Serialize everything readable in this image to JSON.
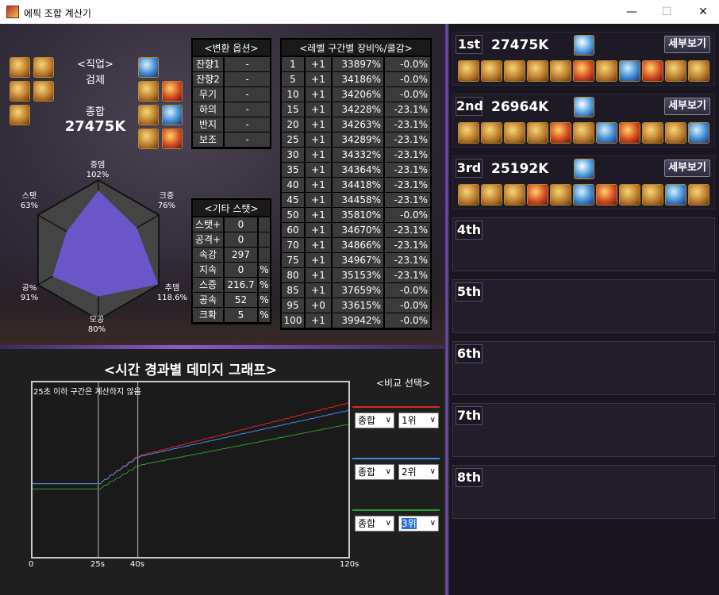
{
  "window": {
    "title": "에픽 조합 계산기",
    "minimize": "—",
    "maximize": "☐",
    "close": "✕"
  },
  "character": {
    "job_label": "<직업>",
    "job": "검제",
    "total_label": "종합",
    "total": "27475K"
  },
  "radar": {
    "labels": [
      {
        "name": "증뎀",
        "value": "102%"
      },
      {
        "name": "크증",
        "value": "76%"
      },
      {
        "name": "추뎀",
        "value": "118.6%"
      },
      {
        "name": "모공",
        "value": "80%"
      },
      {
        "name": "공%",
        "value": "91%"
      },
      {
        "name": "스탯",
        "value": "63%"
      }
    ],
    "levels": [
      1.02,
      0.76,
      1.186,
      0.8,
      0.91,
      0.63
    ]
  },
  "conv_table": {
    "title": "<변환 옵션>",
    "rows": [
      [
        "잔향1",
        "-"
      ],
      [
        "잔향2",
        "-"
      ],
      [
        "무기",
        "-"
      ],
      [
        "하의",
        "-"
      ],
      [
        "반지",
        "-"
      ],
      [
        "보조",
        "-"
      ]
    ]
  },
  "etc_table": {
    "title": "<기타 스탯>",
    "rows": [
      [
        "스탯+",
        "0",
        ""
      ],
      [
        "공격+",
        "0",
        ""
      ],
      [
        "속강",
        "297",
        ""
      ],
      [
        "지속",
        "0",
        "%"
      ],
      [
        "스증",
        "216.7",
        "%"
      ],
      [
        "공속",
        "52",
        "%"
      ],
      [
        "크확",
        "5",
        "%"
      ]
    ]
  },
  "level_table": {
    "title": "<레벨 구간별 장비%/쿨감>",
    "rows": [
      [
        "1",
        "+1",
        "33897%",
        "-0.0%"
      ],
      [
        "5",
        "+1",
        "34186%",
        "-0.0%"
      ],
      [
        "10",
        "+1",
        "34206%",
        "-0.0%"
      ],
      [
        "15",
        "+1",
        "34228%",
        "-23.1%"
      ],
      [
        "20",
        "+1",
        "34263%",
        "-23.1%"
      ],
      [
        "25",
        "+1",
        "34289%",
        "-23.1%"
      ],
      [
        "30",
        "+1",
        "34332%",
        "-23.1%"
      ],
      [
        "35",
        "+1",
        "34364%",
        "-23.1%"
      ],
      [
        "40",
        "+1",
        "34418%",
        "-23.1%"
      ],
      [
        "45",
        "+1",
        "34458%",
        "-23.1%"
      ],
      [
        "50",
        "+1",
        "35810%",
        "-0.0%"
      ],
      [
        "60",
        "+1",
        "34670%",
        "-23.1%"
      ],
      [
        "70",
        "+1",
        "34866%",
        "-23.1%"
      ],
      [
        "75",
        "+1",
        "34967%",
        "-23.1%"
      ],
      [
        "80",
        "+1",
        "35153%",
        "-23.1%"
      ],
      [
        "85",
        "+1",
        "37659%",
        "-0.0%"
      ],
      [
        "95",
        "+0",
        "33615%",
        "-0.0%"
      ],
      [
        "100",
        "+1",
        "39942%",
        "-0.0%"
      ]
    ]
  },
  "graph": {
    "title": "<시간 경과별 데미지 그래프>",
    "note": "25초 이하 구간은 계산하지 않음",
    "x_ticks": [
      "0",
      "25s",
      "40s",
      "120s"
    ],
    "compare_title": "<비교 선택>",
    "compare": [
      {
        "color": "#e02424",
        "type": "종합",
        "rank": "1위"
      },
      {
        "color": "#3d8fe6",
        "type": "종합",
        "rank": "2위"
      },
      {
        "color": "#2f9a2f",
        "type": "종합",
        "rank": "3위"
      }
    ]
  },
  "chart_data": {
    "type": "line",
    "x": [
      0,
      25,
      40,
      120
    ],
    "xlabel": "",
    "ylabel": "",
    "series": [
      {
        "name": "1위",
        "color": "#e02424",
        "values": [
          null,
          0.09,
          0.16,
          0.7
        ]
      },
      {
        "name": "2위",
        "color": "#3d8fe6",
        "values": [
          null,
          0.09,
          0.15,
          0.63
        ]
      },
      {
        "name": "3위",
        "color": "#2f9a2f",
        "values": [
          null,
          0.06,
          0.11,
          0.55
        ]
      }
    ]
  },
  "ranks": [
    {
      "label": "1st",
      "score": "27475K",
      "detail": "세부보기"
    },
    {
      "label": "2nd",
      "score": "26964K",
      "detail": "세부보기"
    },
    {
      "label": "3rd",
      "score": "25192K",
      "detail": "세부보기"
    },
    {
      "label": "4th"
    },
    {
      "label": "5th"
    },
    {
      "label": "6th"
    },
    {
      "label": "7th"
    },
    {
      "label": "8th"
    }
  ]
}
